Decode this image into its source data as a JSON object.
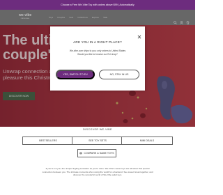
{
  "promo": {
    "text": "Choose a Free We-Vibe Toy with orders above $99 | Automatically"
  },
  "header": {
    "logo": "we-vibe",
    "logo_tagline": "ORIGINAL",
    "nav": [
      "Toys",
      "Couples",
      "Solo",
      "Collections",
      "Explore",
      "Sale"
    ],
    "icons": [
      "search-icon",
      "account-icon",
      "cart-icon"
    ]
  },
  "hero": {
    "title_line1": "The ultimate",
    "title_line2": "couple's gift",
    "subtitle": "Unwrap connection and pleasure this Christmas",
    "cta": "DISCOVER NOW"
  },
  "modal": {
    "title": "ARE YOU IN A RIGHT PLACE?",
    "line1": "We-vibe.com ships to you: only orders to United States",
    "line2": "Would you like to browse our EU shop?",
    "switch_label": "YES, SWITCH TO EU",
    "stay_label": "NO, STAY IN US",
    "close_icon": "close-icon"
  },
  "discover": {
    "title": "DISCOVER WE-VIBE",
    "buttons": [
      "BESTSELLERS",
      "SEE TOY SETS",
      "MINI DEALS"
    ],
    "compare_label": "COMPARE & SAME TOYS"
  },
  "footer": {
    "text": "If you're in sync, the unique tingling sensation as you're done. We-Vibe's sweet toys are all about that special connection between you. The intimate moments when using the world for a backend. See sweet Great together, and discover the wonderful world of We-Vibe adult toys."
  },
  "colors": {
    "brand_purple": "#6d2c7e",
    "hero_red": "#b33a46",
    "cta_green": "#4f6b4e"
  }
}
